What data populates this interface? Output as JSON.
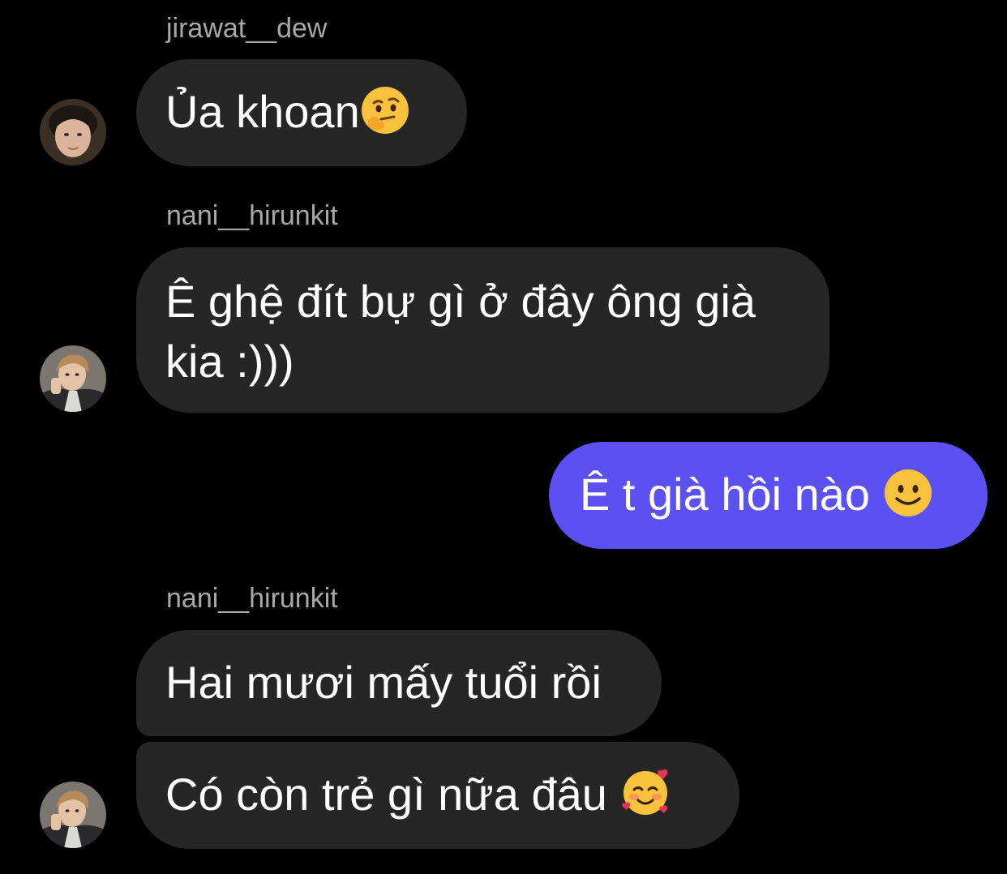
{
  "colors": {
    "background": "#000000",
    "incoming_bubble": "#262626",
    "outgoing_bubble": "#5b51f2",
    "sender_name": "#a8a8a8",
    "text": "#ffffff"
  },
  "messages": [
    {
      "sender": "jirawat__dew",
      "text": "Ủa khoan",
      "emoji": "thinking-face-icon",
      "direction": "incoming"
    },
    {
      "sender": "nani__hirunkit",
      "text": "Ê ghệ đít bự gì ở đây ông già kia :)))",
      "direction": "incoming"
    },
    {
      "text": "Ê t già hồi nào",
      "emoji": "slightly-smiling-face-icon",
      "direction": "outgoing"
    },
    {
      "sender": "nani__hirunkit",
      "text": "Hai mươi mấy tuổi rồi",
      "direction": "incoming"
    },
    {
      "text": "Có còn trẻ gì nữa đâu",
      "emoji": "smiling-face-with-hearts-icon",
      "direction": "incoming"
    }
  ]
}
